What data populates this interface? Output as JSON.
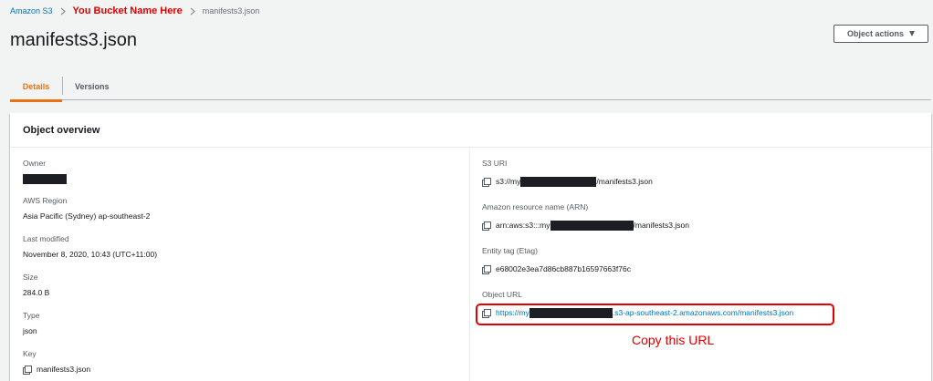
{
  "breadcrumb": {
    "root": "Amazon S3",
    "bucket": "You Bucket Name Here",
    "current": "manifests3.json"
  },
  "page": {
    "title": "manifests3.json",
    "actions_label": "Object actions"
  },
  "tabs": [
    {
      "label": "Details",
      "selected": true
    },
    {
      "label": "Versions",
      "selected": false
    }
  ],
  "overview": {
    "title": "Object overview",
    "left": {
      "owner_label": "Owner",
      "region_label": "AWS Region",
      "region_value": "Asia Pacific (Sydney) ap-southeast-2",
      "modified_label": "Last modified",
      "modified_value": "November 8, 2020, 10:43 (UTC+11:00)",
      "size_label": "Size",
      "size_value": "284.0 B",
      "type_label": "Type",
      "type_value": "json",
      "key_label": "Key",
      "key_value": "manifests3.json"
    },
    "right": {
      "s3uri_label": "S3 URI",
      "s3uri_prefix": "s3://my",
      "s3uri_suffix": "/manifests3.json",
      "arn_label": "Amazon resource name (ARN)",
      "arn_prefix": "arn:aws:s3:::my",
      "arn_suffix": "/manifests3.json",
      "etag_label": "Entity tag (Etag)",
      "etag_value": "e68002e3ea7d86cb887b16597663f76c",
      "url_label": "Object URL",
      "url_prefix": "https://my",
      "url_suffix": ".s3-ap-southeast-2.amazonaws.com/manifests3.json"
    }
  },
  "annotation": {
    "text": "Copy this URL",
    "color": "#e00000"
  },
  "colors": {
    "link": "#0073bb",
    "active_tab": "#ec7211",
    "background": "#f2f3f3",
    "redaction": "#1b1f24"
  },
  "icons": [
    "chevron-right-icon",
    "caret-down-icon",
    "copy-icon"
  ]
}
